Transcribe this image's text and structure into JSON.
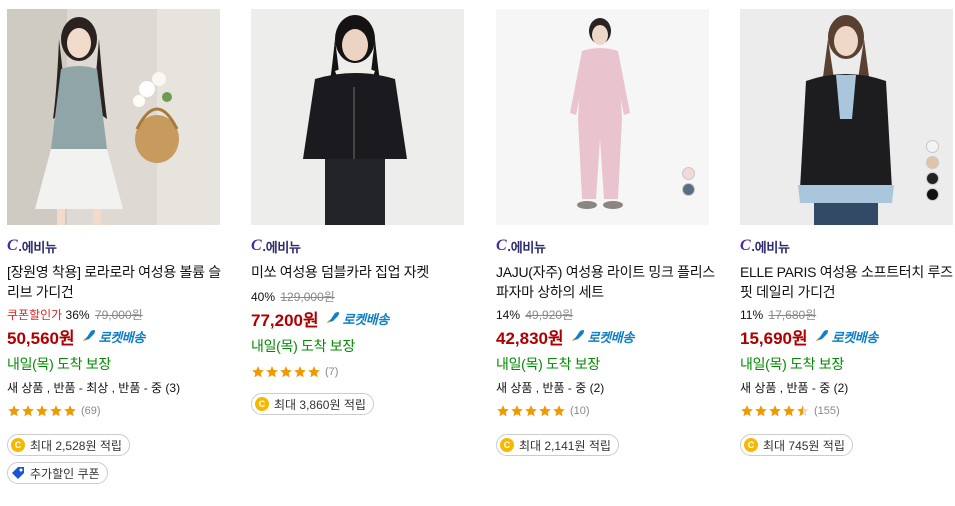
{
  "products": [
    {
      "brand": "에비뉴",
      "title": "[장원영 착용] 로라로라 여성용 볼륨 슬리브 가디건",
      "coupon_label": "쿠폰할인가",
      "discount": "36%",
      "original_price": "79,000원",
      "price": "50,560원",
      "rocket": "로켓배송",
      "delivery": "내일(목) 도착 보장",
      "options": "새 상품 , 반품 - 최상 , 반품 - 중 (3)",
      "rating": 5,
      "rating_count": "(69)",
      "reward": "최대 2,528원 적립",
      "extra_coupon": "추가할인 쿠폰"
    },
    {
      "brand": "에비뉴",
      "title": "미쏘 여성용 덤블카라 집업 자켓",
      "discount": "40%",
      "original_price": "129,000원",
      "price": "77,200원",
      "rocket": "로켓배송",
      "delivery": "내일(목) 도착 보장",
      "rating": 5,
      "rating_count": "(7)",
      "reward": "최대 3,860원 적립"
    },
    {
      "brand": "에비뉴",
      "title": "JAJU(자주) 여성용 라이트 밍크 플리스 파자마 상하의 세트",
      "discount": "14%",
      "original_price": "49,920원",
      "price": "42,830원",
      "rocket": "로켓배송",
      "delivery": "내일(목) 도착 보장",
      "options": "새 상품 , 반품 - 중 (2)",
      "rating": 5,
      "rating_count": "(10)",
      "reward": "최대 2,141원 적립",
      "swatch_colors": [
        "#f2d9d9",
        "#5a6e82"
      ]
    },
    {
      "brand": "에비뉴",
      "title": "ELLE PARIS 여성용 소프트터치 루즈핏 데일리 가디건",
      "discount": "11%",
      "original_price": "17,680원",
      "price": "15,690원",
      "rocket": "로켓배송",
      "delivery": "내일(목) 도착 보장",
      "options": "새 상품 , 반품 - 중 (2)",
      "rating": 4.5,
      "rating_count": "(155)",
      "reward": "최대 745원 적립",
      "swatch_colors": [
        "#f4f4f4",
        "#e0c3a8",
        "#222222",
        "#111111"
      ]
    }
  ],
  "colors": {
    "price": "#ae0000",
    "delivery": "#008c00",
    "rocket": "#0f7fc6",
    "star": "#f29900",
    "coupon": "#e52528"
  }
}
